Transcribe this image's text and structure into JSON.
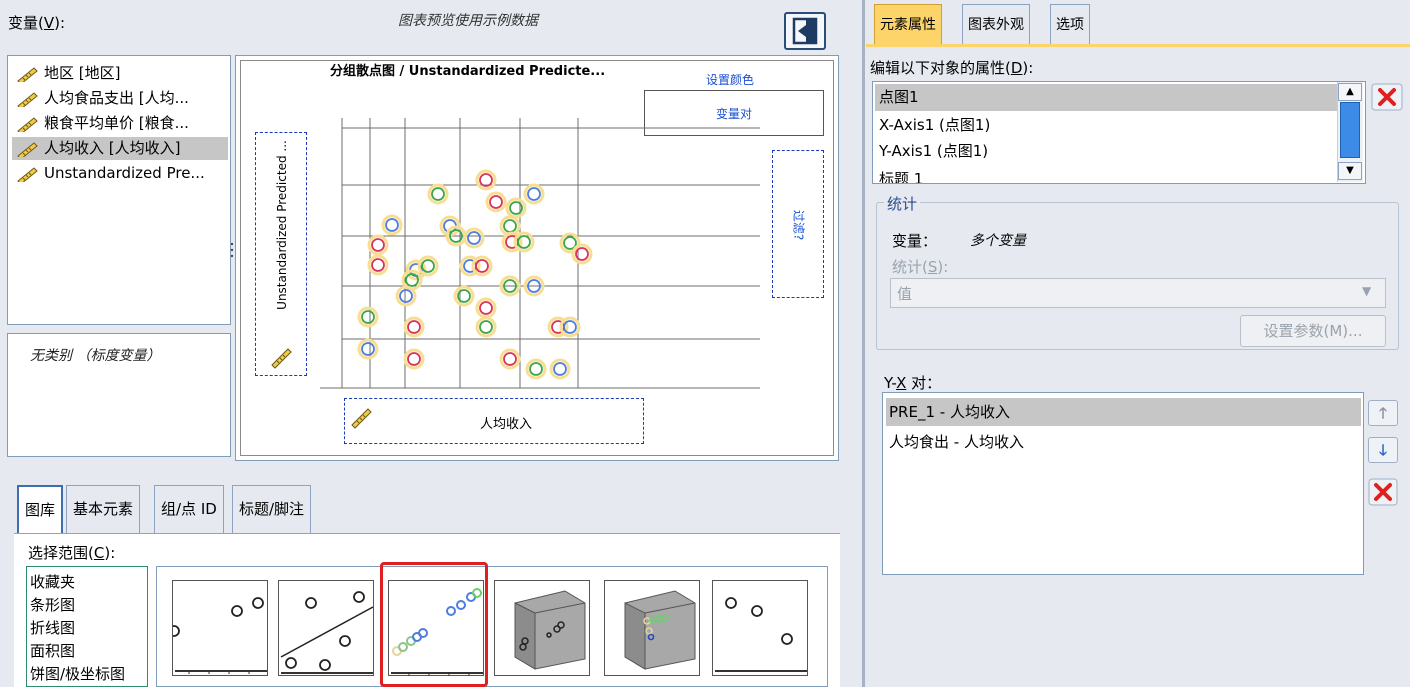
{
  "left_header": {
    "variables_label": "变量(",
    "variables_key": "V",
    "variables_end": "):",
    "preview_note": "图表预览使用示例数据"
  },
  "variables": [
    {
      "label": "地区 [地区]"
    },
    {
      "label": "人均食品支出 [人均..."
    },
    {
      "label": "粮食平均单价 [粮食..."
    },
    {
      "label": "人均收入 [人均收入]"
    },
    {
      "label": "Unstandardized Pre..."
    }
  ],
  "categories_note": "无类别 （标度变量）",
  "canvas": {
    "title": "分组散点图 / Unstandardized Predicte...",
    "set_color": "设置颜色",
    "pair_label": "变量对",
    "filter_label": "过滤?",
    "y_axis_label": "Unstandardized Predicted ...",
    "x_axis_label": "人均收入"
  },
  "bottom_tabs": [
    "图库",
    "基本元素",
    "组/点 ID",
    "标题/脚注"
  ],
  "gallery": {
    "choose_label": "选择范围(",
    "choose_key": "C",
    "choose_end": "):",
    "choose_items": [
      "收藏夹",
      "条形图",
      "折线图",
      "面积图",
      "饼图/极坐标图"
    ]
  },
  "right_tabs": [
    "元素属性",
    "图表外观",
    "选项"
  ],
  "properties": {
    "edit_label": "编辑以下对象的属性(",
    "edit_key": "D",
    "edit_end": "):",
    "objects": [
      "点图1",
      "X-Axis1 (点图1)",
      "Y-Axis1 (点图1)",
      "标题 1"
    ]
  },
  "stats": {
    "legend": "统计",
    "variable_key": "变量：",
    "variable_value": "多个变量",
    "stat_label": "统计(",
    "stat_key": "S",
    "stat_end": "):",
    "stat_value": "值",
    "param_button": "设置参数(M)..."
  },
  "yx": {
    "label_a": "Y-",
    "label_key": "X",
    "label_b": " 对：",
    "pairs": [
      "PRE_1 - 人均收入",
      "人均食出 - 人均收入"
    ]
  },
  "colors": {
    "accent": "#fcd46a",
    "select": "#c6c6c6",
    "border": "#7f9db9",
    "delete": "#e02020",
    "dropzone": "#1a3ab8"
  }
}
